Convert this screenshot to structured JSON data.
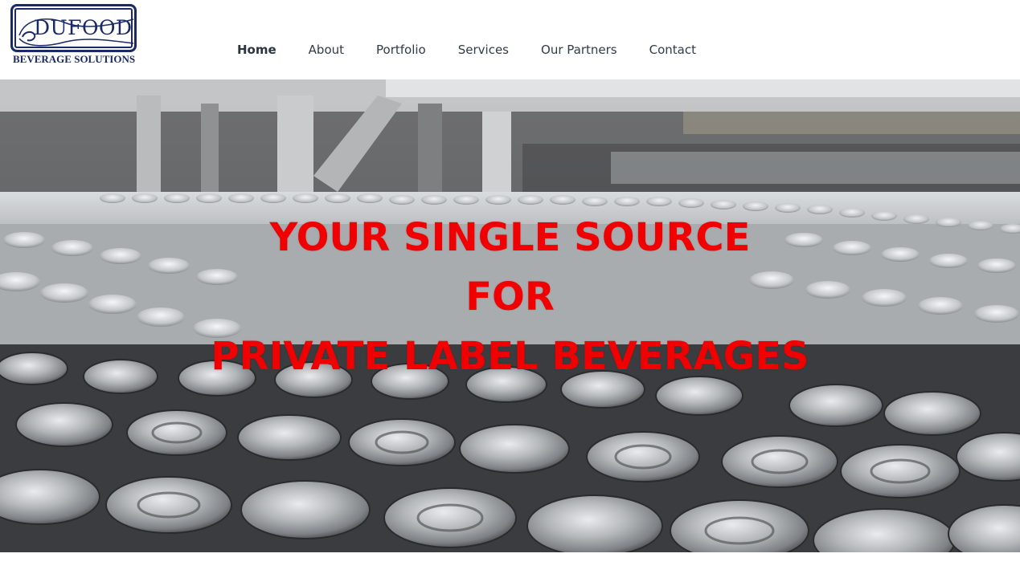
{
  "logo": {
    "word": "DUFOOD",
    "subtitle": "BEVERAGE SOLUTIONS"
  },
  "nav": {
    "items": [
      {
        "label": "Home",
        "active": true
      },
      {
        "label": "About",
        "active": false
      },
      {
        "label": "Portfolio",
        "active": false
      },
      {
        "label": "Services",
        "active": false
      },
      {
        "label": "Our Partners",
        "active": false
      },
      {
        "label": "Contact",
        "active": false
      }
    ]
  },
  "hero": {
    "line1": "YOUR SINGLE SOURCE",
    "line2": "FOR",
    "line3": "PRIVATE LABEL BEVERAGES",
    "image": "aluminum-cans-production-line"
  },
  "colors": {
    "brand_navy": "#1a2a66",
    "headline_red": "#f00000",
    "nav_text": "#333a44"
  }
}
